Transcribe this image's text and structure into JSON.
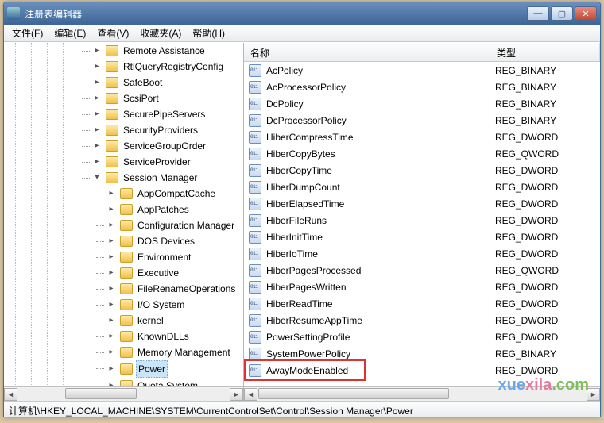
{
  "window": {
    "title": "注册表编辑器"
  },
  "menu": {
    "file": "文件(F)",
    "edit": "编辑(E)",
    "view": "查看(V)",
    "fav": "收藏夹(A)",
    "help": "帮助(H)"
  },
  "tree": {
    "top": [
      "Remote Assistance",
      "RtlQueryRegistryConfig",
      "SafeBoot",
      "ScsiPort",
      "SecurePipeServers",
      "SecurityProviders",
      "ServiceGroupOrder",
      "ServiceProvider"
    ],
    "expanded": "Session Manager",
    "children": [
      "AppCompatCache",
      "AppPatches",
      "Configuration Manager",
      "DOS Devices",
      "Environment",
      "Executive",
      "FileRenameOperations",
      "I/O System",
      "kernel",
      "KnownDLLs",
      "Memory Management",
      "Power",
      "Quota System"
    ],
    "selected": "Power"
  },
  "columns": {
    "name": "名称",
    "type": "类型"
  },
  "values": [
    {
      "n": "AcPolicy",
      "t": "REG_BINARY"
    },
    {
      "n": "AcProcessorPolicy",
      "t": "REG_BINARY"
    },
    {
      "n": "DcPolicy",
      "t": "REG_BINARY"
    },
    {
      "n": "DcProcessorPolicy",
      "t": "REG_BINARY"
    },
    {
      "n": "HiberCompressTime",
      "t": "REG_DWORD"
    },
    {
      "n": "HiberCopyBytes",
      "t": "REG_QWORD"
    },
    {
      "n": "HiberCopyTime",
      "t": "REG_DWORD"
    },
    {
      "n": "HiberDumpCount",
      "t": "REG_DWORD"
    },
    {
      "n": "HiberElapsedTime",
      "t": "REG_DWORD"
    },
    {
      "n": "HiberFileRuns",
      "t": "REG_DWORD"
    },
    {
      "n": "HiberInitTime",
      "t": "REG_DWORD"
    },
    {
      "n": "HiberIoTime",
      "t": "REG_DWORD"
    },
    {
      "n": "HiberPagesProcessed",
      "t": "REG_QWORD"
    },
    {
      "n": "HiberPagesWritten",
      "t": "REG_DWORD"
    },
    {
      "n": "HiberReadTime",
      "t": "REG_DWORD"
    },
    {
      "n": "HiberResumeAppTime",
      "t": "REG_DWORD"
    },
    {
      "n": "PowerSettingProfile",
      "t": "REG_DWORD"
    },
    {
      "n": "SystemPowerPolicy",
      "t": "REG_BINARY"
    },
    {
      "n": "AwayModeEnabled",
      "t": "REG_DWORD"
    }
  ],
  "highlight": "AwayModeEnabled",
  "status": "计算机\\HKEY_LOCAL_MACHINE\\SYSTEM\\CurrentControlSet\\Control\\Session Manager\\Power",
  "watermark": {
    "p1": "xue",
    "p2": "xila",
    "p3": ".com"
  }
}
